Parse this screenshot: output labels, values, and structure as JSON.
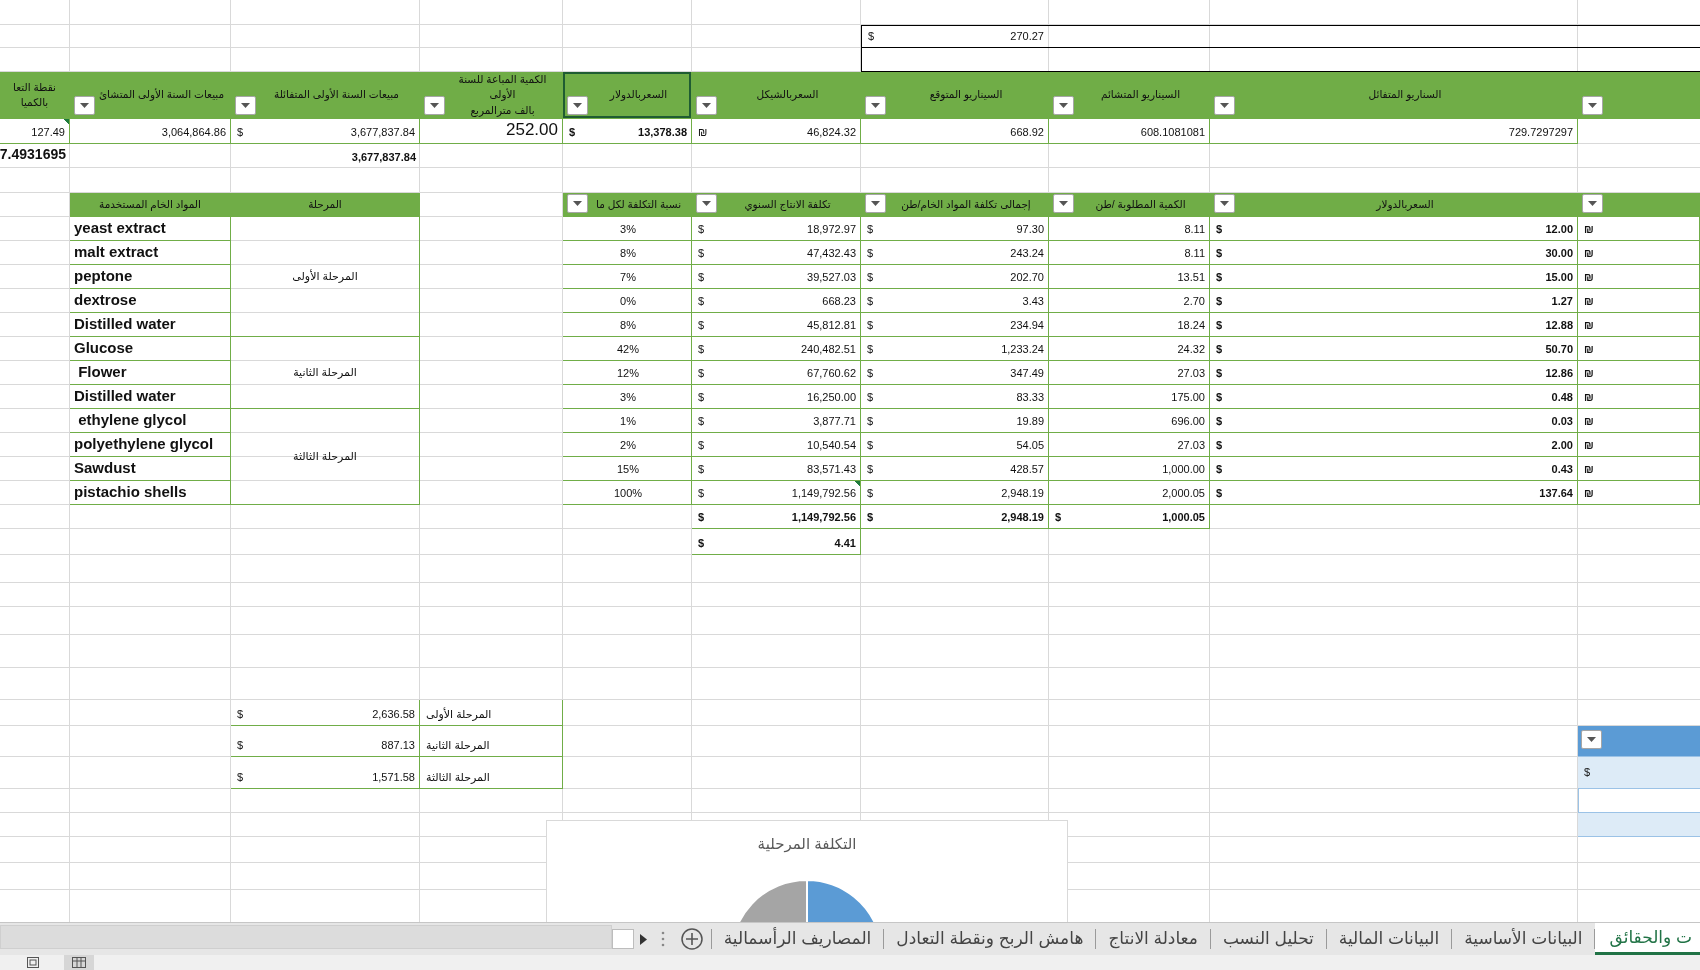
{
  "top_box": {
    "currency": "$",
    "value": "270.27"
  },
  "summary_table": {
    "columns": [
      {
        "label": "نقطة التعا\nبالكميا",
        "filter": false,
        "selected": false
      },
      {
        "label": "مبيعات السنة الأولى المتشائ",
        "filter": true,
        "selected": false
      },
      {
        "label": "مبيعات السنة الأولى المتفائلة",
        "filter": true,
        "selected": false
      },
      {
        "label": "الكمية المباعة للسنة الأولى\nبالف مترالمربع",
        "filter": true,
        "selected": false
      },
      {
        "label": "السعربالدولار",
        "filter": true,
        "selected": true
      },
      {
        "label": "السعربالشيكل",
        "filter": true,
        "selected": false
      },
      {
        "label": "السيناريو المتوقع",
        "filter": true,
        "selected": false
      },
      {
        "label": "السيناريو المتشائم",
        "filter": true,
        "selected": false
      },
      {
        "label": "السناريو المتفائل",
        "filter": true,
        "selected": false
      },
      {
        "filter": true,
        "selected": false
      }
    ],
    "rows": [
      [
        {
          "value": "127.49",
          "flagged": true
        },
        {
          "value": "3,064,864.86"
        },
        {
          "currency": "$",
          "value": "3,677,837.84"
        },
        {
          "value": "252.00",
          "kind": "input"
        },
        {
          "currency": "$",
          "value": "13,378.38",
          "kind": "strong"
        },
        {
          "currency": "₪",
          "value": "46,824.32"
        },
        {
          "value": "668.92"
        },
        {
          "value": "608.1081081"
        },
        {
          "value": "729.7297297"
        },
        null
      ],
      [
        {
          "value": "7.4931695",
          "kind": "headline"
        },
        null,
        {
          "value": "3,677,837.84",
          "kind": "strong"
        },
        null,
        null,
        null,
        null,
        null,
        null,
        null
      ]
    ]
  },
  "materials_table": {
    "columns": [
      {
        "filter": true
      },
      {
        "label": "السعربالدولار",
        "filter": true
      },
      {
        "label": "الكمية المطلوبة /طن",
        "filter": true
      },
      {
        "label": "إجمالى تكلفة المواد الخام/طن",
        "filter": true
      },
      {
        "label": "تكلفة الانتاج السنوي",
        "filter": true
      },
      {
        "label": "نسبة التكلفة لكل ما",
        "filter": true
      },
      {
        "label": "المرحلة",
        "filter": false
      },
      {
        "label": "المواد الخام المستخدمة",
        "filter": false
      }
    ],
    "stages": [
      {
        "label": "المرحلة الأولى",
        "materials": [
          {
            "name": "yeast extract",
            "share": "3%",
            "annual_cost": {
              "currency": "$",
              "value": "18,972.97"
            },
            "cost_per_ton": {
              "currency": "$",
              "value": "97.30"
            },
            "qty_per_ton": "8.11",
            "price_usd": {
              "currency": "$",
              "value": "12.00"
            },
            "price_ils": "₪"
          },
          {
            "name": "malt extract",
            "share": "8%",
            "annual_cost": {
              "currency": "$",
              "value": "47,432.43"
            },
            "cost_per_ton": {
              "currency": "$",
              "value": "243.24"
            },
            "qty_per_ton": "8.11",
            "price_usd": {
              "currency": "$",
              "value": "30.00"
            },
            "price_ils": "₪"
          },
          {
            "name": "peptone",
            "share": "7%",
            "annual_cost": {
              "currency": "$",
              "value": "39,527.03"
            },
            "cost_per_ton": {
              "currency": "$",
              "value": "202.70"
            },
            "qty_per_ton": "13.51",
            "price_usd": {
              "currency": "$",
              "value": "15.00"
            },
            "price_ils": "₪"
          },
          {
            "name": "dextrose",
            "share": "0%",
            "annual_cost": {
              "currency": "$",
              "value": "668.23"
            },
            "cost_per_ton": {
              "currency": "$",
              "value": "3.43"
            },
            "qty_per_ton": "2.70",
            "price_usd": {
              "currency": "$",
              "value": "1.27"
            },
            "price_ils": "₪"
          },
          {
            "name": "Distilled water",
            "share": "8%",
            "annual_cost": {
              "currency": "$",
              "value": "45,812.81"
            },
            "cost_per_ton": {
              "currency": "$",
              "value": "234.94"
            },
            "qty_per_ton": "18.24",
            "price_usd": {
              "currency": "$",
              "value": "12.88"
            },
            "price_ils": "₪"
          }
        ]
      },
      {
        "label": "المرحلة الثانية",
        "materials": [
          {
            "name": "Glucose",
            "share": "42%",
            "annual_cost": {
              "currency": "$",
              "value": "240,482.51"
            },
            "cost_per_ton": {
              "currency": "$",
              "value": "1,233.24"
            },
            "qty_per_ton": "24.32",
            "price_usd": {
              "currency": "$",
              "value": "50.70"
            },
            "price_ils": "₪"
          },
          {
            "name": " Flower",
            "share": "12%",
            "annual_cost": {
              "currency": "$",
              "value": "67,760.62"
            },
            "cost_per_ton": {
              "currency": "$",
              "value": "347.49"
            },
            "qty_per_ton": "27.03",
            "price_usd": {
              "currency": "$",
              "value": "12.86"
            },
            "price_ils": "₪"
          },
          {
            "name": "Distilled water",
            "share": "3%",
            "annual_cost": {
              "currency": "$",
              "value": "16,250.00"
            },
            "cost_per_ton": {
              "currency": "$",
              "value": "83.33"
            },
            "qty_per_ton": "175.00",
            "price_usd": {
              "currency": "$",
              "value": "0.48"
            },
            "price_ils": "₪"
          }
        ]
      },
      {
        "label": "المرحلة الثالثة",
        "materials": [
          {
            "name": " ethylene glycol",
            "share": "1%",
            "annual_cost": {
              "currency": "$",
              "value": "3,877.71"
            },
            "cost_per_ton": {
              "currency": "$",
              "value": "19.89"
            },
            "qty_per_ton": "696.00",
            "price_usd": {
              "currency": "$",
              "value": "0.03"
            },
            "price_ils": "₪"
          },
          {
            "name": "polyethylene glycol",
            "share": "2%",
            "annual_cost": {
              "currency": "$",
              "value": "10,540.54"
            },
            "cost_per_ton": {
              "currency": "$",
              "value": "54.05"
            },
            "qty_per_ton": "27.03",
            "price_usd": {
              "currency": "$",
              "value": "2.00"
            },
            "price_ils": "₪"
          },
          {
            "name": "Sawdust",
            "share": "15%",
            "annual_cost": {
              "currency": "$",
              "value": "83,571.43"
            },
            "cost_per_ton": {
              "currency": "$",
              "value": "428.57"
            },
            "qty_per_ton": "1,000.00",
            "price_usd": {
              "currency": "$",
              "value": "0.43"
            },
            "price_ils": "₪"
          },
          {
            "name": "pistachio shells",
            "share": "100%",
            "annual_cost": {
              "currency": "$",
              "value": "1,149,792.56",
              "flagged": true
            },
            "cost_per_ton": {
              "currency": "$",
              "value": "2,948.19"
            },
            "qty_per_ton": "2,000.05",
            "price_usd": {
              "currency": "$",
              "value": "137.64"
            },
            "price_ils": "₪"
          }
        ]
      }
    ],
    "totals": [
      {
        "currency": "$",
        "value": "1,149,792.56"
      },
      {
        "currency": "$",
        "value": "2,948.19"
      },
      {
        "currency": "$",
        "value": "1,000.05"
      }
    ],
    "per_unit": {
      "currency": "$",
      "value": "4.41"
    }
  },
  "stage_costs": [
    {
      "stage": "المرحلة الأولى",
      "currency": "$",
      "value": "2,636.58"
    },
    {
      "stage": "المرحلة الثانية",
      "currency": "$",
      "value": "887.13"
    },
    {
      "stage": "المرحلة الثالثة",
      "currency": "$",
      "value": "1,571.58"
    }
  ],
  "blue_table": {
    "filter": true,
    "rows": [
      {
        "currency": "$"
      }
    ]
  },
  "chart": {
    "title": "التكلفة المرحلية"
  },
  "sheet_tabs": [
    {
      "label": "ت والحقائق",
      "selected": true
    },
    {
      "label": "البيانات الأساسية",
      "selected": false
    },
    {
      "label": "البيانات المالية",
      "selected": false
    },
    {
      "label": "تحليل النسب",
      "selected": false
    },
    {
      "label": "معادلة الانتاج",
      "selected": false
    },
    {
      "label": "هامش الربح ونقطة التعادل",
      "selected": false
    },
    {
      "label": "المصاريف الرأسمالية",
      "selected": false
    }
  ]
}
